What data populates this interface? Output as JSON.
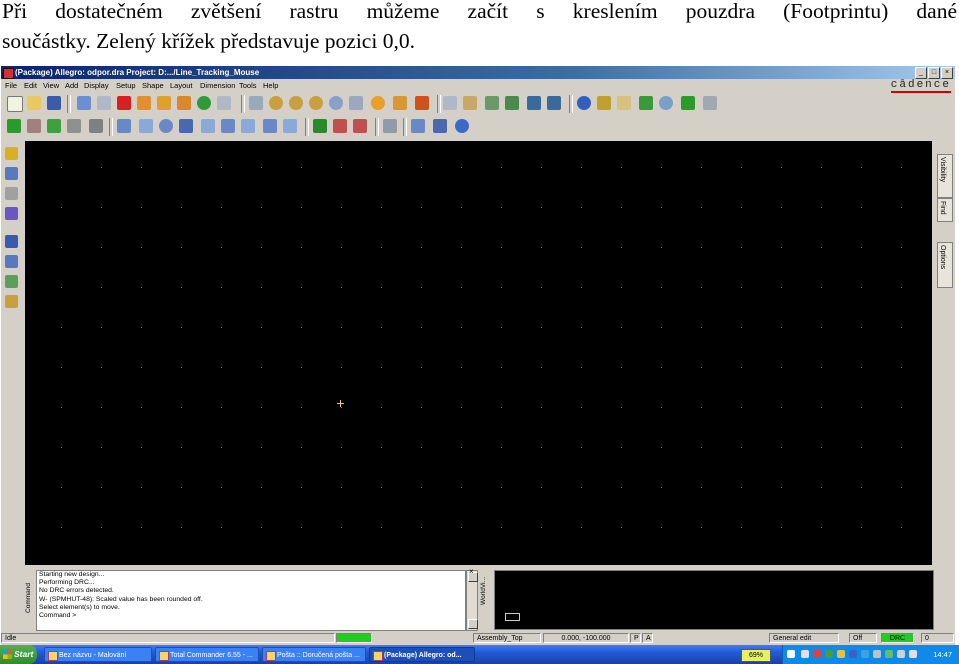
{
  "caption": {
    "line1": "Při dostatečném zvětšení rastru můžeme začít s kreslením pouzdra (Footprintu) dané",
    "line2": "součástky. Zelený křížek představuje pozici 0,0."
  },
  "window": {
    "title": "(Package) Allegro: odpor.dra  Project: D:.../Line_Tracking_Mouse",
    "controls": [
      "_",
      "□",
      "×"
    ],
    "brand": "cādence"
  },
  "menu": [
    "File",
    "Edit",
    "View",
    "Add",
    "Display",
    "Setup",
    "Shape",
    "Layout",
    "Dimension",
    "Tools",
    "Help"
  ],
  "right_tabs": [
    "Visibility",
    "Find",
    "Options"
  ],
  "command_panel": {
    "label": "Command",
    "log": [
      "Starting new design...",
      "Performing DRC...",
      "No DRC errors detected.",
      "W- (SPMHUT-48): Scaled value has been rounded off.",
      "Select element(s) to move.",
      "Command >"
    ]
  },
  "worldview_label": "WorldVi...",
  "status": {
    "state": "Idle",
    "active_class": "Assembly_Top",
    "coords": "0.000, -100.000",
    "p_flag": "P",
    "a_flag": "A",
    "mode": "General edit",
    "off": "Off",
    "drc": "DRC",
    "drc_count": "0"
  },
  "taskbar": {
    "start": "Start",
    "tasks": [
      "Bez názvu - Malování",
      "Total Commander 6.55 - ...",
      "Pošta :: Doručená pošta ...",
      "(Package) Allegro: od..."
    ],
    "zoom": "69%",
    "clock": "14:47"
  },
  "colors": {
    "canvas": "#000000",
    "grid_dot": "#7f7f7f",
    "origin_cross": "#e6c84a",
    "status_green": "#22cc22"
  }
}
